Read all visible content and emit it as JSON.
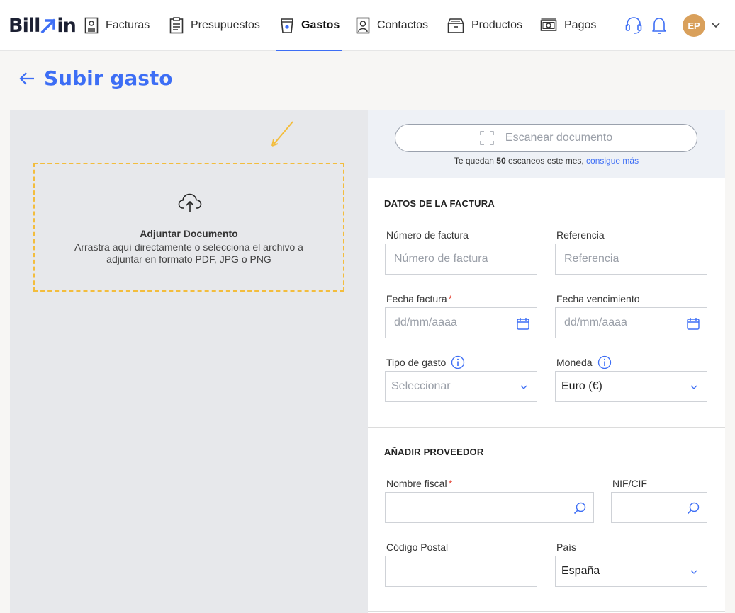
{
  "brand": {
    "logo_text_left": "Bill",
    "logo_text_right": "in",
    "accent": "#3d6ef5"
  },
  "nav": {
    "items": [
      {
        "label": "Facturas",
        "icon": "invoice-icon"
      },
      {
        "label": "Presupuestos",
        "icon": "clipboard-icon"
      },
      {
        "label": "Gastos",
        "icon": "cup-icon",
        "active": true
      },
      {
        "label": "Contactos",
        "icon": "contact-icon"
      },
      {
        "label": "Productos",
        "icon": "box-icon"
      },
      {
        "label": "Pagos",
        "icon": "money-icon"
      }
    ],
    "user_initials": "EP"
  },
  "page": {
    "title": "Subir gasto"
  },
  "upload": {
    "title": "Adjuntar Documento",
    "text": "Arrastra aquí directamente o selecciona el archivo a adjuntar en formato PDF, JPG o PNG"
  },
  "scan": {
    "button_label": "Escanear documento",
    "info_prefix": "Te quedan ",
    "info_count": "50",
    "info_suffix": " escaneos este mes, ",
    "info_link": "consigue más"
  },
  "invoice_section": {
    "title": "DATOS DE LA FACTURA",
    "invoice_number": {
      "label": "Número de factura",
      "placeholder": "Número de factura"
    },
    "reference": {
      "label": "Referencia",
      "placeholder": "Referencia"
    },
    "invoice_date": {
      "label": "Fecha factura",
      "required_mark": "*",
      "placeholder": "dd/mm/aaaa"
    },
    "due_date": {
      "label": "Fecha vencimiento",
      "placeholder": "dd/mm/aaaa"
    },
    "expense_type": {
      "label": "Tipo de gasto",
      "placeholder": "Seleccionar"
    },
    "currency": {
      "label": "Moneda",
      "value": "Euro (€)"
    }
  },
  "supplier_section": {
    "title": "AÑADIR PROVEEDOR",
    "fiscal_name": {
      "label": "Nombre fiscal",
      "required_mark": "*"
    },
    "nif": {
      "label": "NIF/CIF"
    },
    "postal_code": {
      "label": "Código Postal"
    },
    "country": {
      "label": "País",
      "value": "España"
    }
  }
}
